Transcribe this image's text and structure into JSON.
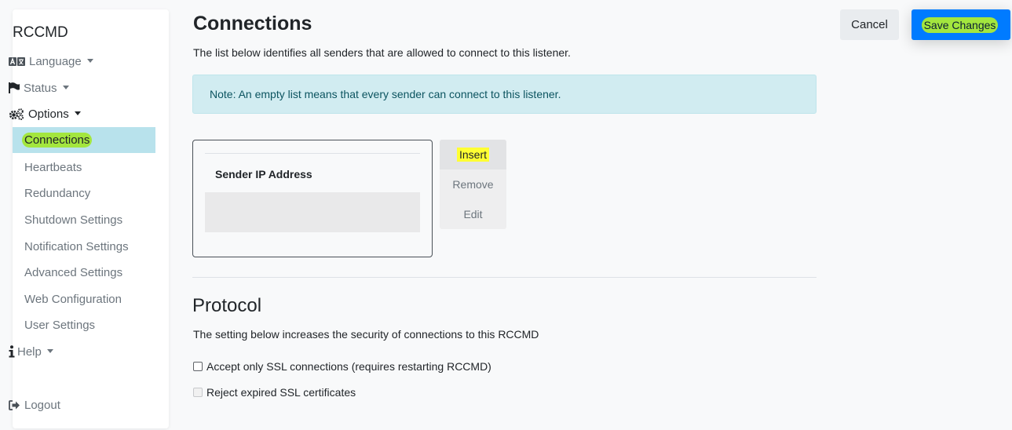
{
  "sidebar": {
    "brand": "RCCMD",
    "language": "Language",
    "status": "Status",
    "options": "Options",
    "items": [
      {
        "label": "Connections",
        "active": true
      },
      {
        "label": "Heartbeats"
      },
      {
        "label": "Redundancy"
      },
      {
        "label": "Shutdown Settings"
      },
      {
        "label": "Notification Settings"
      },
      {
        "label": "Advanced Settings"
      },
      {
        "label": "Web Configuration"
      },
      {
        "label": "User Settings"
      }
    ],
    "help": "Help",
    "logout": "Logout"
  },
  "header": {
    "cancel_label": "Cancel",
    "save_label": "Save Changes"
  },
  "connections": {
    "title": "Connections",
    "description": "The list below identifies all senders that are allowed to connect to this listener.",
    "note": "Note: An empty list means that every sender can connect to this listener.",
    "table": {
      "column_header": "Sender IP Address",
      "rows": []
    },
    "actions": {
      "insert": "Insert",
      "remove": "Remove",
      "edit": "Edit"
    }
  },
  "protocol": {
    "title": "Protocol",
    "description": "The setting below increases the security of connections to this RCCMD",
    "accept_ssl": {
      "label": "Accept only SSL connections (requires restarting RCCMD)",
      "checked": false
    },
    "reject_expired": {
      "label": "Reject expired SSL certificates",
      "checked": false,
      "disabled": true
    }
  },
  "colors": {
    "highlight_green": "#a3e63e",
    "highlight_yellow": "#ffff33",
    "active_item_bg": "#b8e2ec",
    "primary": "#007bff",
    "alert_bg": "#d1ecf1"
  }
}
